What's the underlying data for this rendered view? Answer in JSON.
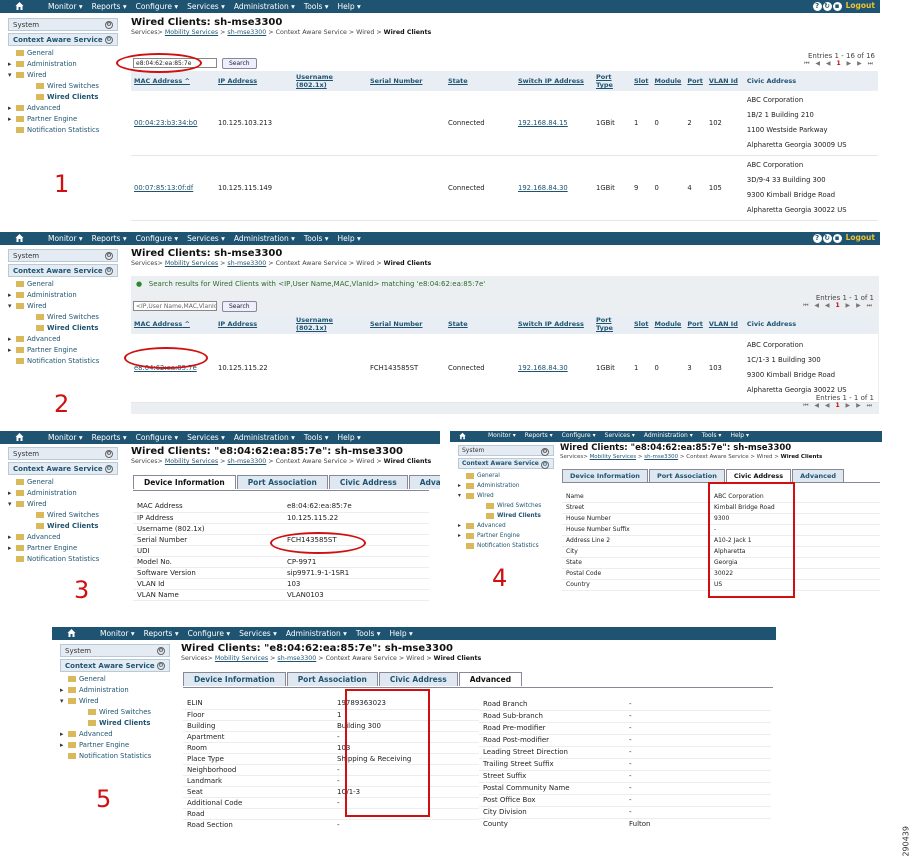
{
  "menu": [
    "Monitor ▾",
    "Reports ▾",
    "Configure ▾",
    "Services ▾",
    "Administration ▾",
    "Tools ▾",
    "Help ▾"
  ],
  "logout": "Logout",
  "sidebar": {
    "system": "System",
    "context": "Context Aware Service",
    "items": [
      "General",
      "Administration",
      "Wired",
      "Wired Switches",
      "Wired Clients",
      "Advanced",
      "Partner Engine",
      "Notification Statistics"
    ]
  },
  "p1": {
    "title": "Wired Clients: sh-mse3300",
    "bc_pre": "Services>",
    "bc_l1": "Mobility Services",
    "bc_l2": "sh-mse3300",
    "bc_mid": "> Context Aware Service > Wired >",
    "bc_end": "Wired Clients",
    "search_value": "e8:04:62:ea:85:7e",
    "search_btn": "Search",
    "entries": "Entries 1 - 16 of 16",
    "columns": [
      "MAC Address ^",
      "IP Address",
      "Username (802.1x)",
      "Serial Number",
      "State",
      "Switch IP Address",
      "Port Type",
      "Slot",
      "Module",
      "Port",
      "VLAN Id",
      "Civic Address"
    ],
    "rows": [
      {
        "mac": "00:04:23:b3:34:b0",
        "ip": "10.125.103.213",
        "user": "",
        "serial": "",
        "state": "Connected",
        "sw": "192.168.84.15",
        "ptype": "1GBit",
        "slot": "1",
        "mod": "0",
        "port": "2",
        "vlan": "102",
        "civic": [
          "ABC Corporation",
          "1B/2 1 Building 210",
          "1100 Westside Parkway",
          "Alpharetta Georgia 30009 US"
        ]
      },
      {
        "mac": "00:07:85:13:0f:df",
        "ip": "10.125.115.149",
        "user": "",
        "serial": "",
        "state": "Connected",
        "sw": "192.168.84.30",
        "ptype": "1GBit",
        "slot": "9",
        "mod": "0",
        "port": "4",
        "vlan": "105",
        "civic": [
          "ABC Corporation",
          "3D/9-4 33 Building 300",
          "9300 Kimball Bridge Road",
          "Alpharetta Georgia 30022 US"
        ]
      }
    ],
    "label": "1"
  },
  "p2": {
    "title": "Wired Clients: sh-mse3300",
    "result": "Search results for Wired Clients with <IP,User Name,MAC,VlanId> matching 'e8:04:62:ea:85:7e'",
    "search_placeholder": "<IP,User Name,MAC,VlanId>",
    "search_btn": "Search",
    "entries": "Entries 1 - 1 of 1",
    "row": {
      "mac": "e8:04:62:ea:85:7e",
      "ip": "10.125.115.22",
      "user": "",
      "serial": "FCH143585ST",
      "state": "Connected",
      "sw": "192.168.84.30",
      "ptype": "1GBit",
      "slot": "1",
      "mod": "0",
      "port": "3",
      "vlan": "103",
      "civic": [
        "ABC Corporation",
        "1C/1-3 1 Building 300",
        "9300 Kimball Bridge Road",
        "Alpharetta Georgia 30022 US"
      ]
    },
    "label": "2"
  },
  "detail_title": "Wired Clients: \"e8:04:62:ea:85:7e\": sh-mse3300",
  "tabs": [
    "Device Information",
    "Port Association",
    "Civic Address",
    "Advanced"
  ],
  "p3": {
    "rows": [
      [
        "MAC Address",
        "e8:04:62:ea:85:7e"
      ],
      [
        "IP Address",
        "10.125.115.22"
      ],
      [
        "Username (802.1x)",
        ""
      ],
      [
        "Serial Number",
        "FCH143585ST"
      ],
      [
        "UDI",
        ""
      ],
      [
        "Model No.",
        "CP-9971"
      ],
      [
        "Software Version",
        "sip9971.9-1-1SR1"
      ],
      [
        "VLAN Id",
        "103"
      ],
      [
        "VLAN Name",
        "VLAN0103"
      ]
    ],
    "label": "3"
  },
  "p4": {
    "rows": [
      [
        "Name",
        "ABC Corporation"
      ],
      [
        "Street",
        "Kimball Bridge Road"
      ],
      [
        "House Number",
        "9300"
      ],
      [
        "House Number Suffix",
        "-"
      ],
      [
        "Address Line 2",
        "A10-2 Jack 1"
      ],
      [
        "City",
        "Alpharetta"
      ],
      [
        "State",
        "Georgia"
      ],
      [
        "Postal Code",
        "30022"
      ],
      [
        "Country",
        "US"
      ]
    ],
    "label": "4"
  },
  "p5": {
    "left": [
      [
        "ELIN",
        "19789363023"
      ],
      [
        "Floor",
        "1"
      ],
      [
        "Building",
        "Building 300"
      ],
      [
        "Apartment",
        "-"
      ],
      [
        "Room",
        "103"
      ],
      [
        "Place Type",
        "Shipping & Receiving"
      ],
      [
        "Neighborhood",
        "-"
      ],
      [
        "Landmark",
        "-"
      ],
      [
        "Seat",
        "1C/1-3"
      ],
      [
        "Additional Code",
        "-"
      ],
      [
        "Road",
        ""
      ],
      [
        "Road Section",
        "-"
      ]
    ],
    "right": [
      [
        "Road Branch",
        "-"
      ],
      [
        "Road Sub-branch",
        "-"
      ],
      [
        "Road Pre-modifier",
        "-"
      ],
      [
        "Road Post-modifier",
        "-"
      ],
      [
        "Leading Street Direction",
        "-"
      ],
      [
        "Trailing Street Suffix",
        "-"
      ],
      [
        "Street Suffix",
        "-"
      ],
      [
        "Postal Community Name",
        "-"
      ],
      [
        "Post Office Box",
        "-"
      ],
      [
        "City Division",
        "-"
      ],
      [
        "County",
        "Fulton"
      ]
    ],
    "label": "5"
  },
  "figure_id": "290439"
}
